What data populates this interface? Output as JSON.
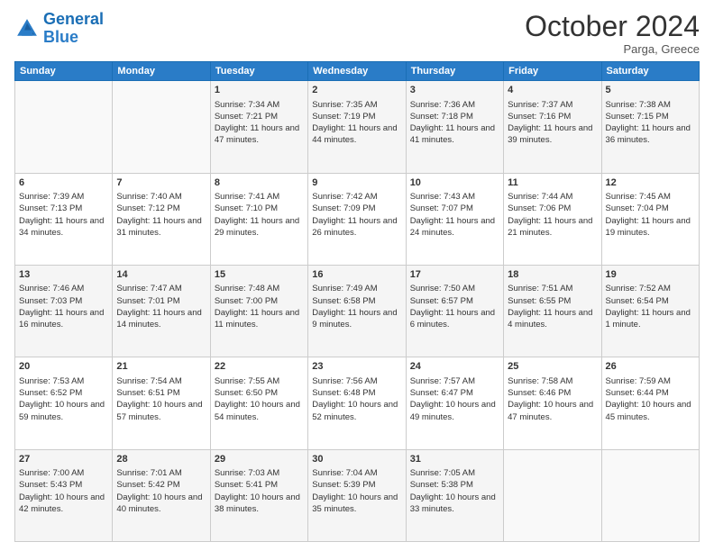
{
  "header": {
    "logo_line1": "General",
    "logo_line2": "Blue",
    "month": "October 2024",
    "location": "Parga, Greece"
  },
  "days_of_week": [
    "Sunday",
    "Monday",
    "Tuesday",
    "Wednesday",
    "Thursday",
    "Friday",
    "Saturday"
  ],
  "weeks": [
    [
      {
        "day": "",
        "info": ""
      },
      {
        "day": "",
        "info": ""
      },
      {
        "day": "1",
        "info": "Sunrise: 7:34 AM\nSunset: 7:21 PM\nDaylight: 11 hours and 47 minutes."
      },
      {
        "day": "2",
        "info": "Sunrise: 7:35 AM\nSunset: 7:19 PM\nDaylight: 11 hours and 44 minutes."
      },
      {
        "day": "3",
        "info": "Sunrise: 7:36 AM\nSunset: 7:18 PM\nDaylight: 11 hours and 41 minutes."
      },
      {
        "day": "4",
        "info": "Sunrise: 7:37 AM\nSunset: 7:16 PM\nDaylight: 11 hours and 39 minutes."
      },
      {
        "day": "5",
        "info": "Sunrise: 7:38 AM\nSunset: 7:15 PM\nDaylight: 11 hours and 36 minutes."
      }
    ],
    [
      {
        "day": "6",
        "info": "Sunrise: 7:39 AM\nSunset: 7:13 PM\nDaylight: 11 hours and 34 minutes."
      },
      {
        "day": "7",
        "info": "Sunrise: 7:40 AM\nSunset: 7:12 PM\nDaylight: 11 hours and 31 minutes."
      },
      {
        "day": "8",
        "info": "Sunrise: 7:41 AM\nSunset: 7:10 PM\nDaylight: 11 hours and 29 minutes."
      },
      {
        "day": "9",
        "info": "Sunrise: 7:42 AM\nSunset: 7:09 PM\nDaylight: 11 hours and 26 minutes."
      },
      {
        "day": "10",
        "info": "Sunrise: 7:43 AM\nSunset: 7:07 PM\nDaylight: 11 hours and 24 minutes."
      },
      {
        "day": "11",
        "info": "Sunrise: 7:44 AM\nSunset: 7:06 PM\nDaylight: 11 hours and 21 minutes."
      },
      {
        "day": "12",
        "info": "Sunrise: 7:45 AM\nSunset: 7:04 PM\nDaylight: 11 hours and 19 minutes."
      }
    ],
    [
      {
        "day": "13",
        "info": "Sunrise: 7:46 AM\nSunset: 7:03 PM\nDaylight: 11 hours and 16 minutes."
      },
      {
        "day": "14",
        "info": "Sunrise: 7:47 AM\nSunset: 7:01 PM\nDaylight: 11 hours and 14 minutes."
      },
      {
        "day": "15",
        "info": "Sunrise: 7:48 AM\nSunset: 7:00 PM\nDaylight: 11 hours and 11 minutes."
      },
      {
        "day": "16",
        "info": "Sunrise: 7:49 AM\nSunset: 6:58 PM\nDaylight: 11 hours and 9 minutes."
      },
      {
        "day": "17",
        "info": "Sunrise: 7:50 AM\nSunset: 6:57 PM\nDaylight: 11 hours and 6 minutes."
      },
      {
        "day": "18",
        "info": "Sunrise: 7:51 AM\nSunset: 6:55 PM\nDaylight: 11 hours and 4 minutes."
      },
      {
        "day": "19",
        "info": "Sunrise: 7:52 AM\nSunset: 6:54 PM\nDaylight: 11 hours and 1 minute."
      }
    ],
    [
      {
        "day": "20",
        "info": "Sunrise: 7:53 AM\nSunset: 6:52 PM\nDaylight: 10 hours and 59 minutes."
      },
      {
        "day": "21",
        "info": "Sunrise: 7:54 AM\nSunset: 6:51 PM\nDaylight: 10 hours and 57 minutes."
      },
      {
        "day": "22",
        "info": "Sunrise: 7:55 AM\nSunset: 6:50 PM\nDaylight: 10 hours and 54 minutes."
      },
      {
        "day": "23",
        "info": "Sunrise: 7:56 AM\nSunset: 6:48 PM\nDaylight: 10 hours and 52 minutes."
      },
      {
        "day": "24",
        "info": "Sunrise: 7:57 AM\nSunset: 6:47 PM\nDaylight: 10 hours and 49 minutes."
      },
      {
        "day": "25",
        "info": "Sunrise: 7:58 AM\nSunset: 6:46 PM\nDaylight: 10 hours and 47 minutes."
      },
      {
        "day": "26",
        "info": "Sunrise: 7:59 AM\nSunset: 6:44 PM\nDaylight: 10 hours and 45 minutes."
      }
    ],
    [
      {
        "day": "27",
        "info": "Sunrise: 7:00 AM\nSunset: 5:43 PM\nDaylight: 10 hours and 42 minutes."
      },
      {
        "day": "28",
        "info": "Sunrise: 7:01 AM\nSunset: 5:42 PM\nDaylight: 10 hours and 40 minutes."
      },
      {
        "day": "29",
        "info": "Sunrise: 7:03 AM\nSunset: 5:41 PM\nDaylight: 10 hours and 38 minutes."
      },
      {
        "day": "30",
        "info": "Sunrise: 7:04 AM\nSunset: 5:39 PM\nDaylight: 10 hours and 35 minutes."
      },
      {
        "day": "31",
        "info": "Sunrise: 7:05 AM\nSunset: 5:38 PM\nDaylight: 10 hours and 33 minutes."
      },
      {
        "day": "",
        "info": ""
      },
      {
        "day": "",
        "info": ""
      }
    ]
  ]
}
